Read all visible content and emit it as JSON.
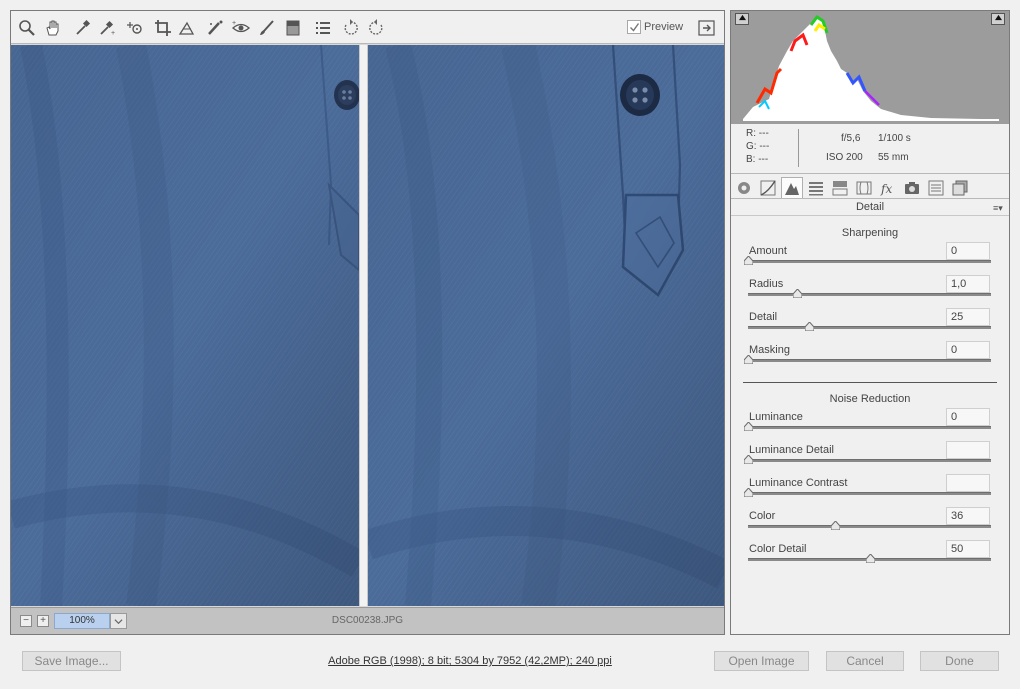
{
  "toolbar": {
    "tools": [
      "zoom-tool-icon",
      "hand-tool-icon",
      "white-balance-tool-icon",
      "color-sampler-tool-icon",
      "targeted-adjustment-tool-icon",
      "crop-tool-icon",
      "straighten-tool-icon",
      "spot-removal-tool-icon",
      "red-eye-removal-tool-icon",
      "adjustment-brush-icon",
      "graduated-filter-icon",
      "preferences-icon",
      "rotate-left-icon",
      "rotate-right-icon"
    ],
    "preview_label": "Preview",
    "preview_checked": true
  },
  "image": {
    "zoom": "100%",
    "filename": "DSC00238.JPG"
  },
  "histogram": {
    "colors": {
      "background": "#9c9c9c"
    }
  },
  "readout": {
    "r": "R:  ---",
    "g": "G:  ---",
    "b": "B:  ---",
    "aperture": "f/5,6",
    "shutter": "1/100 s",
    "iso": "ISO 200",
    "focal": "55 mm"
  },
  "tabs": [
    "basic-tab-icon",
    "tone-curve-tab-icon",
    "detail-tab-icon",
    "hsl-tab-icon",
    "split-toning-tab-icon",
    "lens-corrections-tab-icon",
    "effects-tab-icon",
    "camera-calibration-tab-icon",
    "presets-tab-icon",
    "snapshots-tab-icon"
  ],
  "panel": {
    "title": "Detail",
    "menu_icon": "panel-menu-icon",
    "sharpening": {
      "title": "Sharpening",
      "sliders": [
        {
          "label": "Amount",
          "value": "0",
          "pos": 0.0
        },
        {
          "label": "Radius",
          "value": "1,0",
          "pos": 0.2
        },
        {
          "label": "Detail",
          "value": "25",
          "pos": 0.25
        },
        {
          "label": "Masking",
          "value": "0",
          "pos": 0.0
        }
      ]
    },
    "noise": {
      "title": "Noise Reduction",
      "sliders": [
        {
          "label": "Luminance",
          "value": "0",
          "pos": 0.0
        },
        {
          "label": "Luminance Detail",
          "value": "",
          "pos": 0.0
        },
        {
          "label": "Luminance Contrast",
          "value": "",
          "pos": 0.0
        },
        {
          "label": "Color",
          "value": "36",
          "pos": 0.36
        },
        {
          "label": "Color Detail",
          "value": "50",
          "pos": 0.5
        }
      ]
    }
  },
  "footer": {
    "save_label": "Save Image...",
    "workflow": "Adobe RGB (1998); 8 bit; 5304 by 7952 (42,2MP); 240 ppi",
    "open_label": "Open Image",
    "cancel_label": "Cancel",
    "done_label": "Done"
  }
}
